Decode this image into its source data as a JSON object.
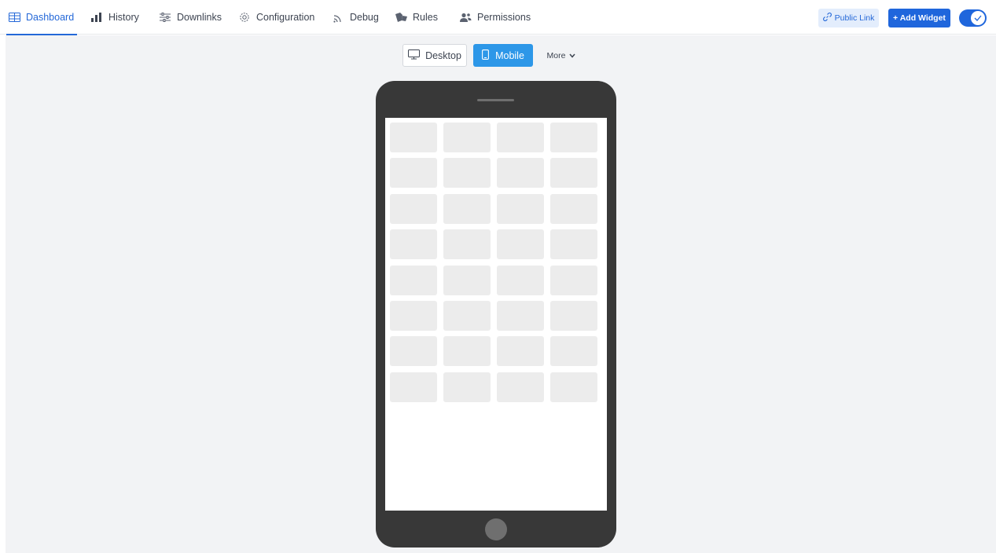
{
  "nav": {
    "tabs": [
      {
        "label": "Dashboard",
        "icon": "table-icon",
        "active": true
      },
      {
        "label": "History",
        "icon": "bar-chart-icon"
      },
      {
        "label": "Downlinks",
        "icon": "sliders-icon"
      },
      {
        "label": "Configuration",
        "icon": "gear-icon"
      },
      {
        "label": "Debug",
        "icon": "rss-icon"
      },
      {
        "label": "Rules",
        "icon": "rules-icon"
      },
      {
        "label": "Permissions",
        "icon": "users-icon"
      }
    ],
    "public_link_label": "Public Link",
    "add_widget_label": "+ Add Widget",
    "toggle_on": true
  },
  "view_switch": {
    "desktop_label": "Desktop",
    "mobile_label": "Mobile",
    "more_label": "More",
    "selected": "Mobile"
  },
  "phone": {
    "grid_rows": 8,
    "grid_cols": 4
  },
  "colors": {
    "accent": "#2468d8",
    "mobile_button": "#2d97e8",
    "canvas_bg": "#f2f3f5",
    "phone_body": "#383838"
  }
}
